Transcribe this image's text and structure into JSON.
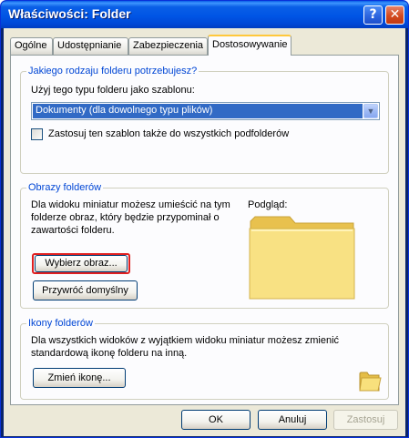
{
  "window": {
    "title": "Właściwości: Folder",
    "help_glyph": "?",
    "close_glyph": "✕"
  },
  "tabs": [
    {
      "label": "Ogólne"
    },
    {
      "label": "Udostępnianie"
    },
    {
      "label": "Zabezpieczenia"
    },
    {
      "label": "Dostosowywanie",
      "active": true
    }
  ],
  "folder_type": {
    "legend": "Jakiego rodzaju folderu potrzebujesz?",
    "template_label": "Użyj tego typu folderu jako szablonu:",
    "template_value": "Dokumenty (dla dowolnego typu plików)",
    "apply_subfolders_label": "Zastosuj ten szablon także do wszystkich podfolderów",
    "apply_subfolders_checked": false
  },
  "folder_pictures": {
    "legend": "Obrazy folderów",
    "description_line1": "Dla widoku miniatur możesz umieścić na tym",
    "description_line2": "folderze obraz, który będzie przypominał o",
    "description_line3": "zawartości folderu.",
    "choose_button": "Wybierz obraz...",
    "restore_button": "Przywróć domyślny",
    "preview_label": "Podgląd:"
  },
  "folder_icons": {
    "legend": "Ikony folderów",
    "description_line1": "Dla wszystkich widoków z wyjątkiem widoku miniatur możesz zmienić",
    "description_line2": "standardową ikonę folderu na inną.",
    "change_button": "Zmień ikonę..."
  },
  "dialog_buttons": {
    "ok": "OK",
    "cancel": "Anuluj",
    "apply": "Zastosuj"
  },
  "colors": {
    "titlebar": "#0055e5",
    "accent_text": "#0046d5",
    "selection": "#316ac5",
    "highlight_frame": "#e02020",
    "folder": "#f6dc6e"
  }
}
